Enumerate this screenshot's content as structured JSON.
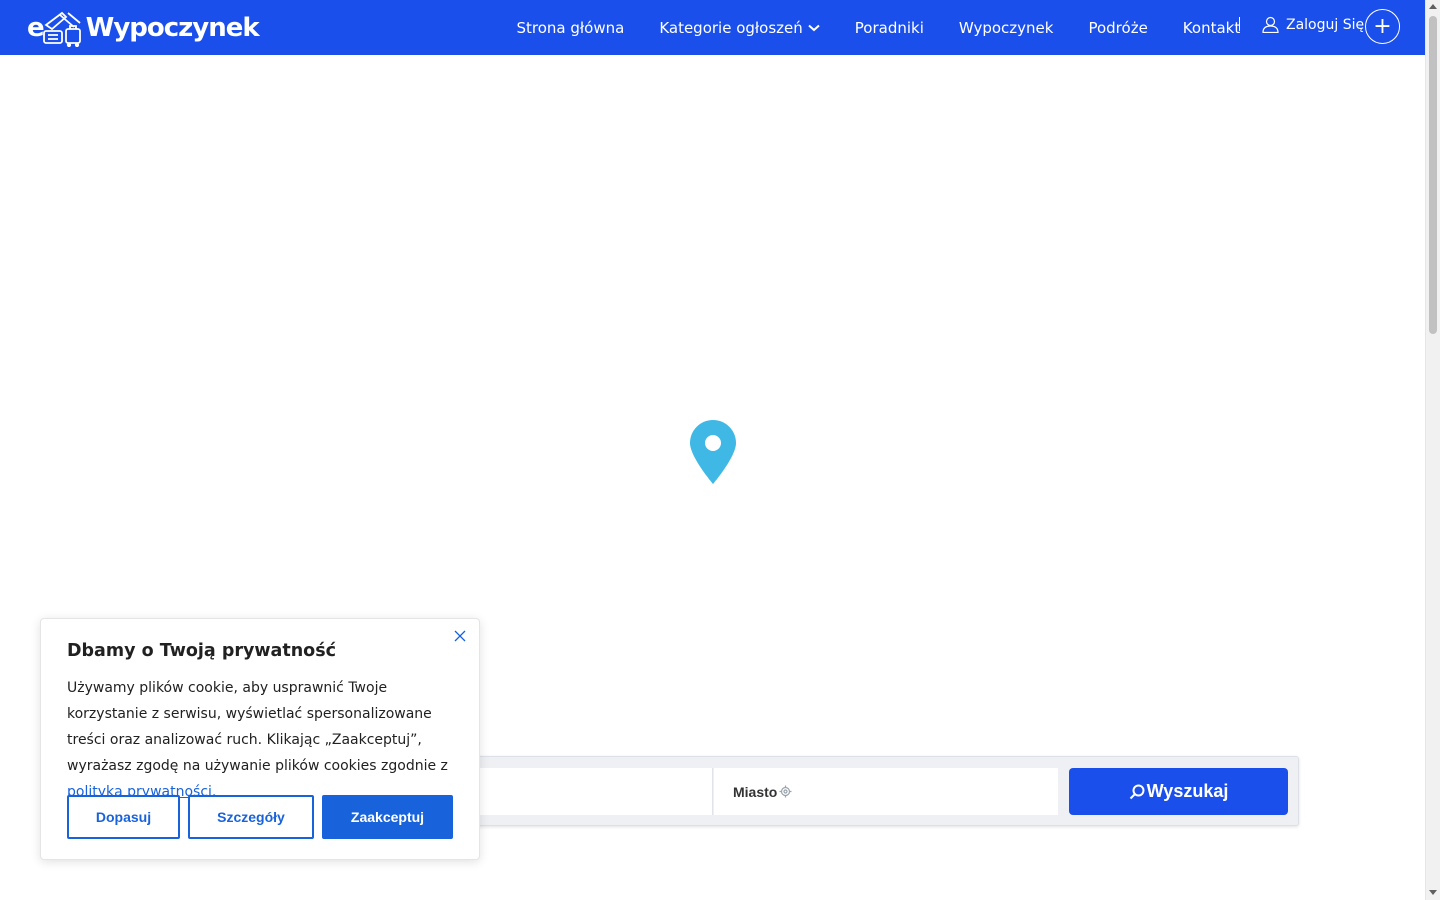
{
  "header": {
    "logo_prefix": "e",
    "logo_name": "Wypoczynek",
    "nav": [
      {
        "label": "Strona główna"
      },
      {
        "label": "Kategorie ogłoszeń"
      },
      {
        "label": "Poradniki"
      },
      {
        "label": "Wypoczynek"
      },
      {
        "label": "Podróże"
      },
      {
        "label": "Kontakt"
      }
    ],
    "login_label": "Zaloguj Się",
    "add_label": "+"
  },
  "search": {
    "city_label": "Miasto",
    "button_label": "Wyszukaj"
  },
  "cookie": {
    "title": "Dbamy o Twoją prywatność",
    "text": "Używamy plików cookie, aby usprawnić Twoje korzystanie z serwisu, wyświetlać spersonalizowane treści oraz analizować ruch. Klikając „Zaakceptuj”, wyrażasz zgodę na używanie plików cookies zgodnie z ",
    "link": "polityką prywatności.",
    "btn_customize": "Dopasuj",
    "btn_details": "Szczegóły",
    "btn_accept": "Zaakceptuj"
  },
  "colors": {
    "brand": "#1a4fec",
    "cookie_accent": "#1863dc",
    "pin": "#3fb8e6"
  },
  "icons": {
    "pin": "map-pin-icon",
    "login": "user-icon",
    "search": "magnifier-icon",
    "locate": "crosshair-icon",
    "close": "close-icon",
    "dropdown": "chevron-down-icon"
  }
}
